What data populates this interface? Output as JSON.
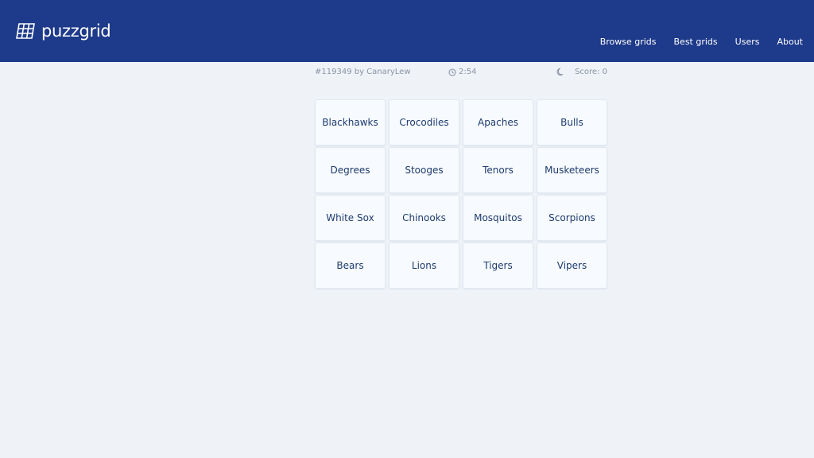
{
  "brand": {
    "name": "puzzgrid"
  },
  "nav": [
    {
      "label": "Browse grids"
    },
    {
      "label": "Best grids"
    },
    {
      "label": "Users"
    },
    {
      "label": "About"
    }
  ],
  "meta": {
    "puzzle_info": "#119349 by CanaryLew",
    "timer": "2:54",
    "score": "Score: 0"
  },
  "grid": {
    "tiles": [
      "Blackhawks",
      "Crocodiles",
      "Apaches",
      "Bulls",
      "Degrees",
      "Stooges",
      "Tenors",
      "Musketeers",
      "White Sox",
      "Chinooks",
      "Mosquitos",
      "Scorpions",
      "Bears",
      "Lions",
      "Tigers",
      "Vipers"
    ]
  },
  "icons": {
    "logo": "grid-logo-icon",
    "timer": "clock-icon",
    "theme": "moon-icon"
  },
  "colors": {
    "header_bg": "#1e3a8a",
    "page_bg": "#eff3f8",
    "tile_bg": "#f7fbff",
    "tile_text": "#1e3a6e",
    "meta_text": "#8a93a3"
  }
}
